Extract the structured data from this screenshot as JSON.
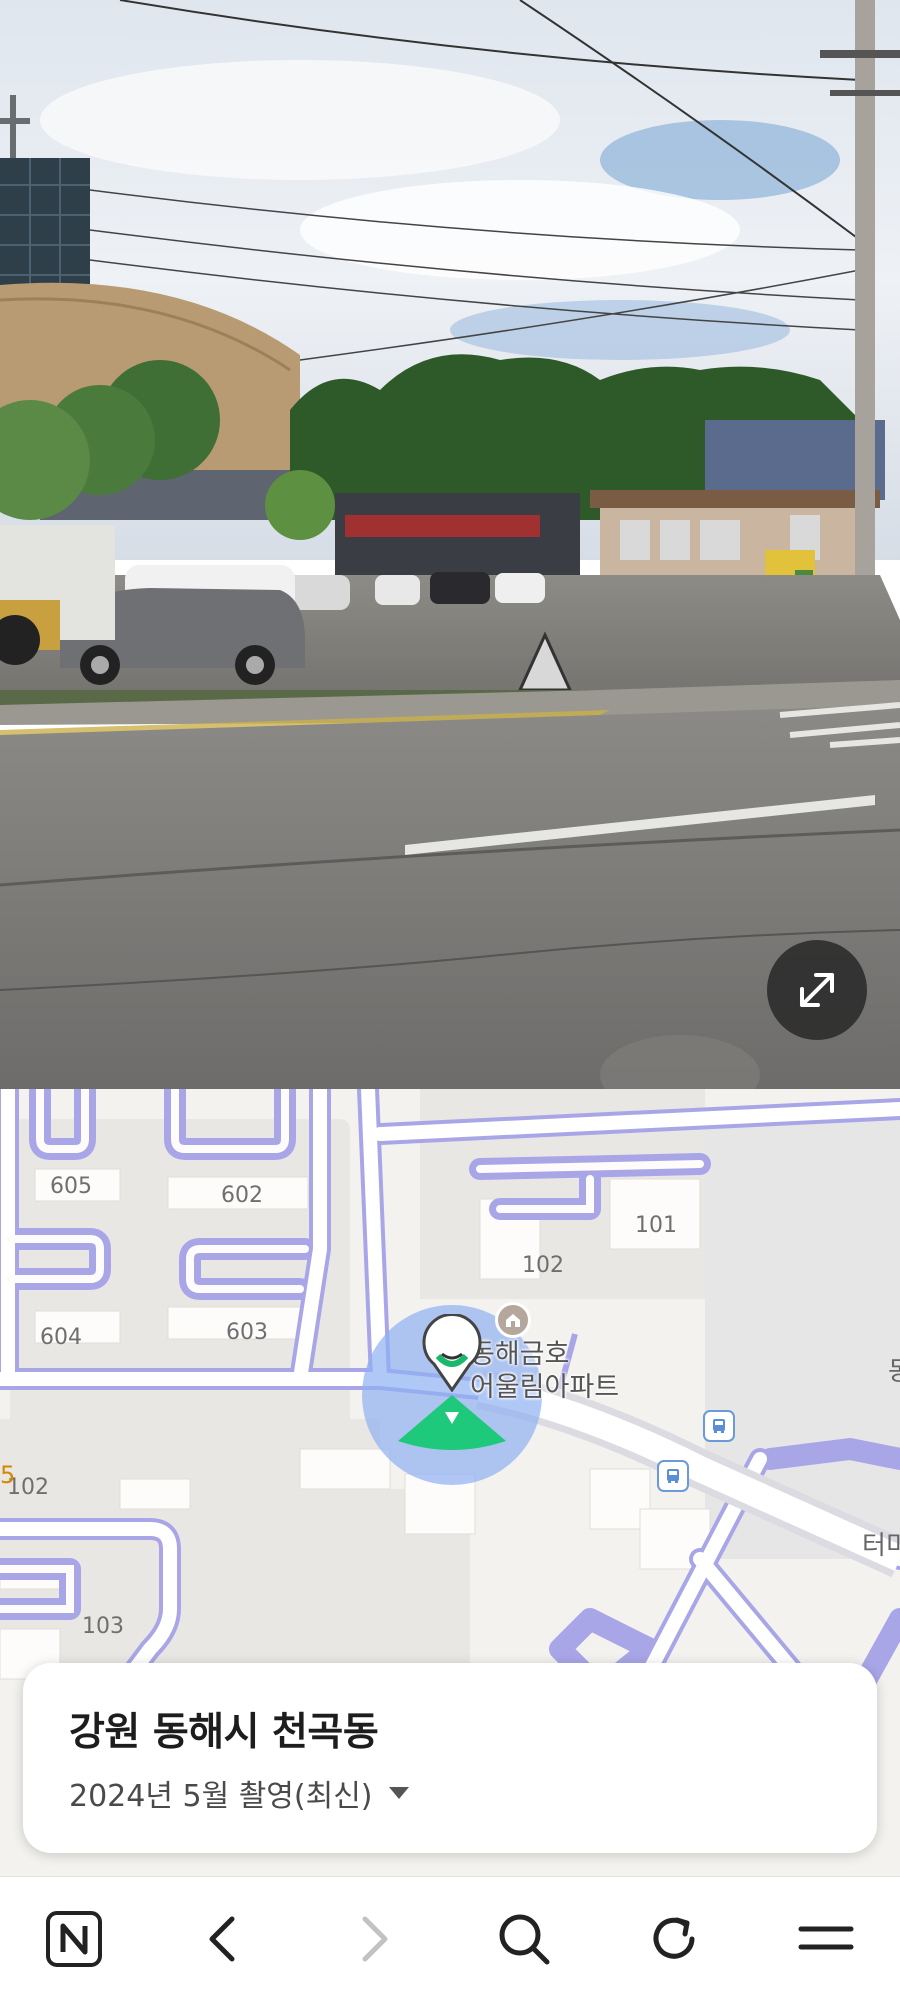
{
  "streetview": {
    "expand_button_icon": "expand-arrows-icon"
  },
  "map": {
    "building_labels": [
      "605",
      "602",
      "101",
      "102",
      "604",
      "603",
      "102",
      "103"
    ],
    "apartment_name_line1": "동해금호",
    "apartment_name_line2": "어울림아파트",
    "left_edge_number": "5",
    "right_edge_text": "터미",
    "right_edge_text_top": "동",
    "colors": {
      "road_outline": "#a9a6e8",
      "road_fill": "#ffffff",
      "block_fill": "#e9e7e3",
      "view_cone": "#1fc97b",
      "view_circle": "#8fb0f2"
    }
  },
  "location_card": {
    "title": "강원 동해시 천곡동",
    "capture_date": "2024년 5월 촬영(최신)"
  },
  "bottom_bar": {
    "icons": [
      "naver-home-icon",
      "back-arrow-icon",
      "forward-arrow-icon",
      "search-icon",
      "refresh-icon",
      "menu-icon"
    ]
  }
}
